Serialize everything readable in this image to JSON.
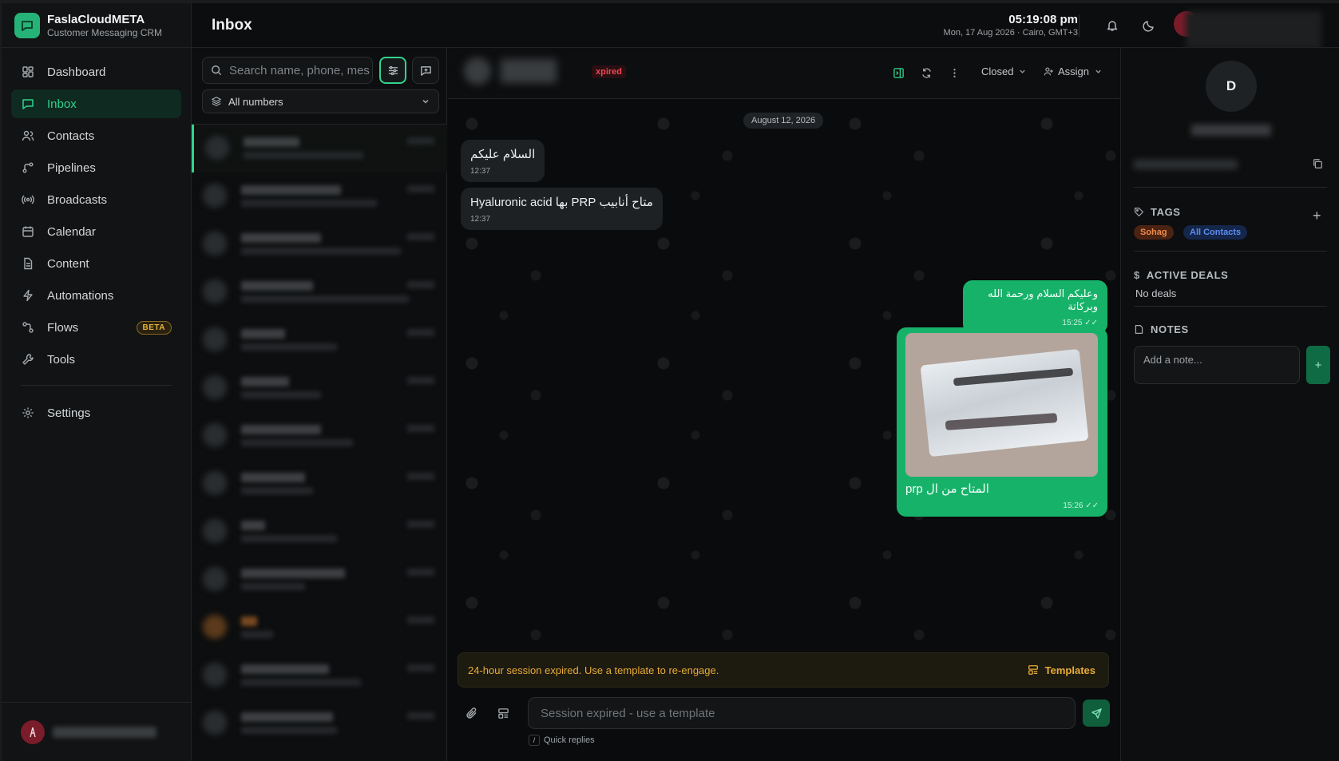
{
  "brand": {
    "name": "FaslaCloudMETA",
    "subtitle": "Customer Messaging CRM",
    "accent": "#25b377"
  },
  "sidebar": {
    "items": [
      {
        "label": "Dashboard",
        "icon": "dashboard-icon"
      },
      {
        "label": "Inbox",
        "icon": "inbox-icon",
        "active": true
      },
      {
        "label": "Contacts",
        "icon": "contacts-icon"
      },
      {
        "label": "Pipelines",
        "icon": "pipelines-icon"
      },
      {
        "label": "Broadcasts",
        "icon": "broadcast-icon"
      },
      {
        "label": "Calendar",
        "icon": "calendar-icon"
      },
      {
        "label": "Content",
        "icon": "document-icon"
      },
      {
        "label": "Automations",
        "icon": "bolt-icon"
      },
      {
        "label": "Flows",
        "icon": "flows-icon",
        "badge": "BETA"
      },
      {
        "label": "Tools",
        "icon": "wrench-icon"
      }
    ],
    "settings_label": "Settings"
  },
  "header": {
    "title": "Inbox",
    "time": "05:19:08 pm",
    "date": "Mon, 17 Aug 2026 · Cairo, GMT+3"
  },
  "conversations": {
    "search_placeholder": "Search name, phone, mes",
    "number_filter": "All numbers"
  },
  "chat": {
    "status_badge": "xpired",
    "status_select": "Closed",
    "assign_label": "Assign",
    "date_separator": "August 12, 2026",
    "messages": [
      {
        "dir": "in",
        "text": "السلام عليكم",
        "time": "12:37"
      },
      {
        "dir": "in",
        "text": "متاح أنابيب PRP بها Hyaluronic acid",
        "time": "12:37"
      },
      {
        "dir": "out",
        "text": "وعليكم السلام ورحمة الله وبركاتة",
        "time": "15:25"
      },
      {
        "dir": "out",
        "text": "المتاح من ال prp",
        "time": "15:26",
        "has_image": true
      }
    ],
    "expired_notice": "24-hour session expired. Use a template to re-engage.",
    "templates_label": "Templates",
    "composer_placeholder": "Session expired - use a template",
    "quick_key": "/",
    "quick_label": "Quick replies"
  },
  "contact_panel": {
    "avatar_letter": "D",
    "tags_title": "TAGS",
    "tags": [
      "Sohag",
      "All Contacts"
    ],
    "deals_title": "ACTIVE DEALS",
    "deals_empty": "No deals",
    "notes_title": "NOTES",
    "note_placeholder": "Add a note..."
  }
}
